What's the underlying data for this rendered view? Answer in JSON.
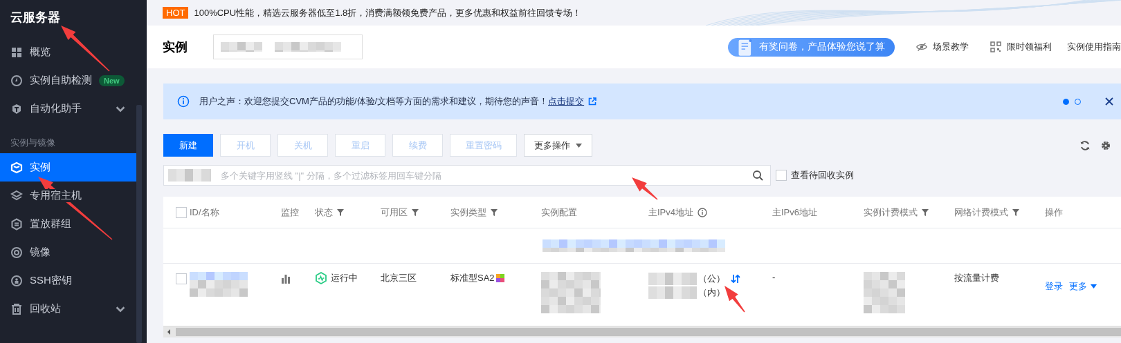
{
  "sidebar": {
    "title": "云服务器",
    "items": [
      {
        "kind": "item",
        "label": "概览",
        "selected": false
      },
      {
        "kind": "item",
        "label": "实例自助检测",
        "badge": "New",
        "selected": false
      },
      {
        "kind": "group",
        "label": "自动化助手",
        "selected": false
      },
      {
        "kind": "section",
        "label": "实例与镜像"
      },
      {
        "kind": "item",
        "label": "实例",
        "selected": true
      },
      {
        "kind": "item",
        "label": "专用宿主机",
        "selected": false
      },
      {
        "kind": "item",
        "label": "置放群组",
        "selected": false
      },
      {
        "kind": "item",
        "label": "镜像",
        "selected": false
      },
      {
        "kind": "item",
        "label": "SSH密钥",
        "selected": false
      },
      {
        "kind": "group",
        "label": "回收站",
        "selected": false
      }
    ]
  },
  "banner": {
    "badge": "HOT",
    "text": "100%CPU性能，精选云服务器低至1.8折，消费满额领免费产品，更多优惠和权益前往回馈专场！"
  },
  "header": {
    "title": "实例",
    "survey": "有奖问卷，产品体验您说了算",
    "links": [
      {
        "label": "场景教学"
      },
      {
        "label": "限时领福利"
      },
      {
        "label": "实例使用指南"
      }
    ]
  },
  "notice": {
    "text": "用户之声：欢迎您提交CVM产品的功能/体验/文档等方面的需求和建议，期待您的声音！",
    "link": "点击提交",
    "pages": [
      {
        "selected": true
      },
      {
        "selected": false
      }
    ]
  },
  "toolbar": {
    "buttons": [
      {
        "kind": "primary",
        "label": "新建",
        "disabled": false
      },
      {
        "kind": "plain",
        "label": "开机",
        "disabled": true
      },
      {
        "kind": "plain",
        "label": "关机",
        "disabled": true
      },
      {
        "kind": "plain",
        "label": "重启",
        "disabled": true
      },
      {
        "kind": "plain",
        "label": "续费",
        "disabled": true
      },
      {
        "kind": "plain",
        "label": "重置密码",
        "disabled": true
      },
      {
        "kind": "dropdown",
        "label": "更多操作",
        "disabled": false
      }
    ]
  },
  "search": {
    "placeholder": "多个关键字用竖线 \"|\" 分隔，多个过滤标签用回车键分隔",
    "recycle": {
      "label": "查看待回收实例",
      "checked": false
    }
  },
  "table": {
    "select_all": {
      "checked": false
    },
    "columns": [
      {
        "label": "ID/名称",
        "kind": "plain"
      },
      {
        "label": "监控",
        "kind": "plain"
      },
      {
        "label": "状态",
        "kind": "filter"
      },
      {
        "label": "可用区",
        "kind": "filter"
      },
      {
        "label": "实例类型",
        "kind": "filter"
      },
      {
        "label": "实例配置",
        "kind": "plain"
      },
      {
        "label": "主IPv4地址",
        "kind": "info"
      },
      {
        "label": "主IPv6地址",
        "kind": "plain"
      },
      {
        "label": "实例计费模式",
        "kind": "filter"
      },
      {
        "label": "网络计费模式",
        "kind": "filter"
      },
      {
        "label": "操作",
        "kind": "plain"
      }
    ],
    "rows": [
      {
        "kind": "group"
      },
      {
        "kind": "instance",
        "checked": false,
        "status": "运行中",
        "zone": "北京三区",
        "type": "标准型SA2",
        "public_ip_suffix": "（公）",
        "private_ip_suffix": "（内）",
        "ipv6": "-",
        "network_billing": "按流量计费",
        "actions": [
          "登录",
          "更多"
        ]
      }
    ]
  }
}
